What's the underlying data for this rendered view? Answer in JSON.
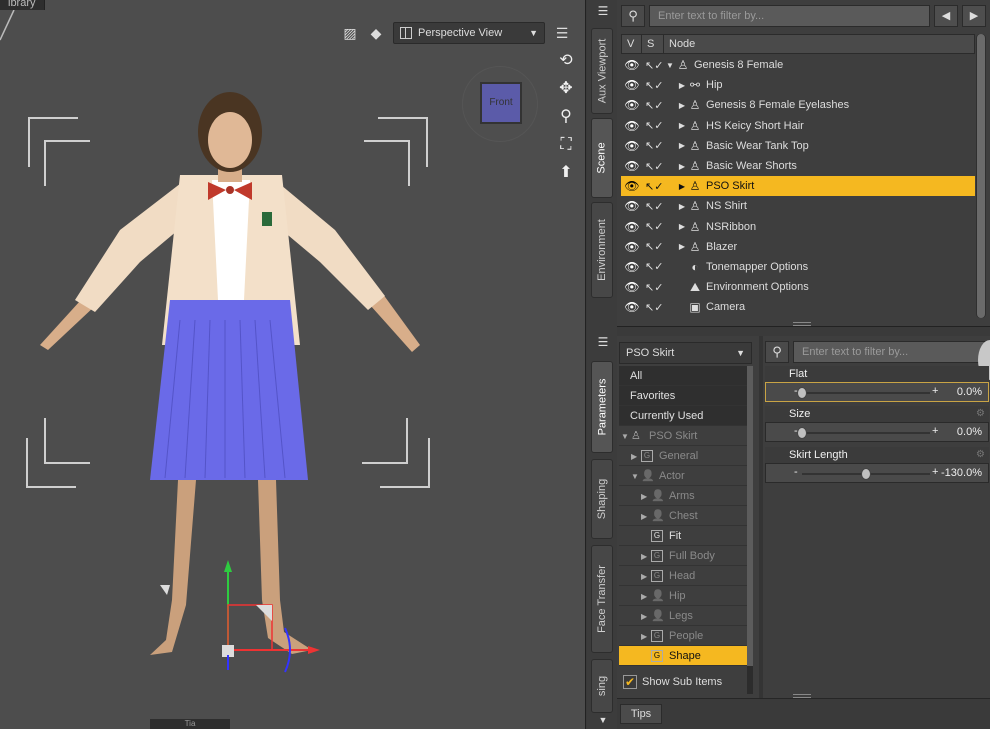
{
  "viewport": {
    "top_label": "ibrary",
    "view_select": "Perspective View",
    "cube_face": "Front",
    "bottom_label": "Tia"
  },
  "side_tabs_top": [
    "Aux Viewport",
    "Scene",
    "Environment"
  ],
  "side_tabs_bottom": [
    "Parameters",
    "Shaping",
    "Face Transfer",
    "sing"
  ],
  "scene": {
    "filter_placeholder": "Enter text to filter by...",
    "col_v": "V",
    "col_s": "S",
    "col_node": "Node",
    "rows": [
      {
        "label": "Genesis 8 Female",
        "expander": "▼",
        "icon": "figure-icon",
        "selected": false
      },
      {
        "label": "Hip",
        "expander": "▶",
        "icon": "bone-icon",
        "selected": false
      },
      {
        "label": "Genesis 8 Female Eyelashes",
        "expander": "▶",
        "icon": "figure-icon",
        "selected": false
      },
      {
        "label": "HS Keicy Short Hair",
        "expander": "▶",
        "icon": "figure-icon",
        "selected": false
      },
      {
        "label": "Basic Wear Tank Top",
        "expander": "▶",
        "icon": "figure-icon",
        "selected": false
      },
      {
        "label": "Basic Wear Shorts",
        "expander": "▶",
        "icon": "figure-icon",
        "selected": false
      },
      {
        "label": "PSO Skirt",
        "expander": "▶",
        "icon": "figure-icon",
        "selected": true
      },
      {
        "label": "NS Shirt",
        "expander": "▶",
        "icon": "figure-icon",
        "selected": false
      },
      {
        "label": "NSRibbon",
        "expander": "▶",
        "icon": "figure-icon",
        "selected": false
      },
      {
        "label": "Blazer",
        "expander": "▶",
        "icon": "figure-icon",
        "selected": false
      },
      {
        "label": "Tonemapper Options",
        "expander": "",
        "icon": "tonemapper-icon",
        "selected": false
      },
      {
        "label": "Environment Options",
        "expander": "",
        "icon": "environment-icon",
        "selected": false
      },
      {
        "label": "Camera",
        "expander": "",
        "icon": "camera-icon",
        "selected": false
      }
    ]
  },
  "parameters": {
    "node": "PSO Skirt",
    "filter_placeholder": "Enter text to filter by...",
    "categories": [
      {
        "label": "All",
        "style": "top",
        "expander": "",
        "box": ""
      },
      {
        "label": "Favorites",
        "style": "top",
        "expander": "",
        "box": ""
      },
      {
        "label": "Currently Used",
        "style": "top",
        "expander": "",
        "box": ""
      },
      {
        "label": "PSO Skirt",
        "style": "dim",
        "expander": "▼",
        "box": "figure"
      },
      {
        "label": "General",
        "style": "dim",
        "expander": "▶",
        "box": "G"
      },
      {
        "label": "Actor",
        "style": "dim",
        "expander": "▼",
        "box": "person"
      },
      {
        "label": "Arms",
        "style": "dim",
        "expander": "▶",
        "box": "person"
      },
      {
        "label": "Chest",
        "style": "dim",
        "expander": "▶",
        "box": "person"
      },
      {
        "label": "Fit",
        "style": "normal",
        "expander": "",
        "box": "G"
      },
      {
        "label": "Full Body",
        "style": "dim",
        "expander": "▶",
        "box": "G"
      },
      {
        "label": "Head",
        "style": "dim",
        "expander": "▶",
        "box": "G"
      },
      {
        "label": "Hip",
        "style": "dim",
        "expander": "▶",
        "box": "person"
      },
      {
        "label": "Legs",
        "style": "dim",
        "expander": "▶",
        "box": "person"
      },
      {
        "label": "People",
        "style": "dim",
        "expander": "▶",
        "box": "G"
      },
      {
        "label": "Shape",
        "style": "sel",
        "expander": "",
        "box": "G"
      }
    ],
    "show_sub_items": "Show Sub Items",
    "tips_tab": "Tips",
    "sliders": [
      {
        "label": "Flat",
        "value": "0.0%",
        "fraction": 0.0,
        "highlight": true
      },
      {
        "label": "Size",
        "value": "0.0%",
        "fraction": 0.0,
        "highlight": false
      },
      {
        "label": "Skirt Length",
        "value": "-130.0%",
        "fraction": 0.5,
        "highlight": false
      }
    ]
  }
}
